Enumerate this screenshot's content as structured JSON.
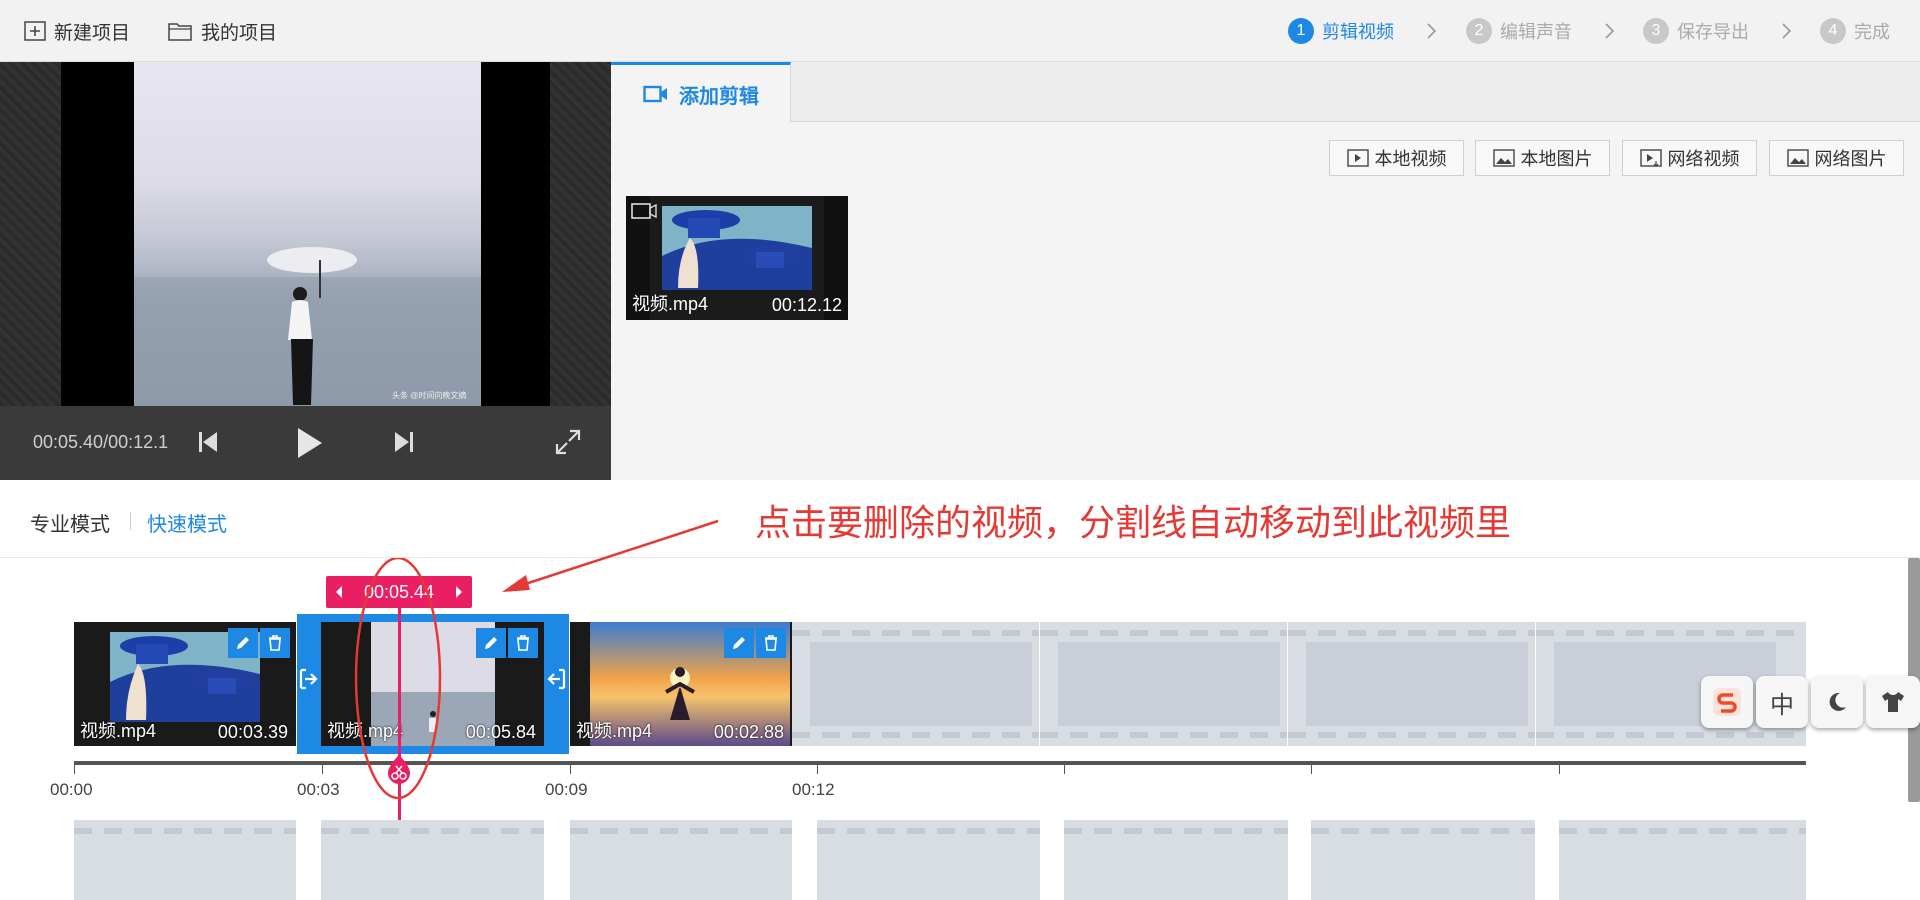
{
  "topbar": {
    "new_project": "新建项目",
    "my_projects": "我的项目",
    "steps": [
      {
        "num": "1",
        "label": "剪辑视频"
      },
      {
        "num": "2",
        "label": "编辑声音"
      },
      {
        "num": "3",
        "label": "保存导出"
      },
      {
        "num": "4",
        "label": "完成"
      }
    ]
  },
  "preview": {
    "time": "00:05.40/00:12.1",
    "watermark": "头条 @时间向晚文摘"
  },
  "panel": {
    "tab_label": "添加剪辑",
    "buttons": [
      "本地视频",
      "本地图片",
      "网络视频",
      "网络图片"
    ],
    "media": {
      "name": "视频.mp4",
      "duration": "00:12.12"
    }
  },
  "modes": {
    "pro": "专业模式",
    "quick": "快速模式"
  },
  "annotation": "点击要删除的视频，分割线自动移动到此视频里",
  "timeline": {
    "playhead_time": "00:05.44",
    "clips": [
      {
        "name": "视频.mp4",
        "duration": "00:03.39"
      },
      {
        "name": "视频.mp4",
        "duration": "00:05.84"
      },
      {
        "name": "视频.mp4",
        "duration": "00:02.88"
      }
    ],
    "ruler": [
      "00:00",
      "00:03",
      "00:09",
      "00:12"
    ]
  },
  "ime_toolbar": {
    "lang": "中"
  },
  "colors": {
    "accent": "#1e88e5",
    "playhead": "#e91e63",
    "annotation": "#e53935"
  }
}
